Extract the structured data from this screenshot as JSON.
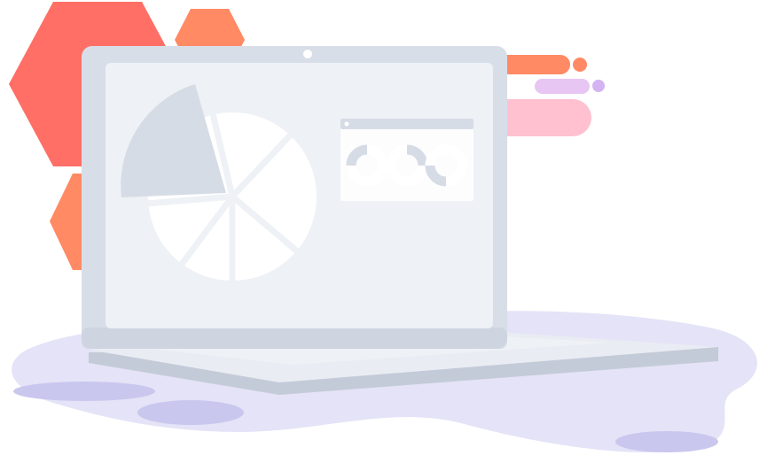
{
  "illustration": {
    "subject": "laptop-with-charts",
    "colors": {
      "background": "#ffffff",
      "puddle": "#e4e3f7",
      "puddle_dark": "#c9c7ee",
      "hex_light": "#ff8a64",
      "hex_dark": "#ff6f66",
      "bar_orange": "#ff8a64",
      "bar_lavender": "#e7c6f3",
      "bar_violet": "#d4b3f3",
      "bar_pink": "#ffc1cf",
      "laptop_frame": "#d8dee8",
      "laptop_screen": "#eef1f5",
      "laptop_base": "#e9ecf2",
      "laptop_edge": "#c4cbd8",
      "chart_accent": "#d6dce5",
      "chart_slice": "#ffffff"
    },
    "icons": [
      "pie-chart-icon",
      "donut-chart-icon",
      "camera-dot-icon"
    ]
  }
}
